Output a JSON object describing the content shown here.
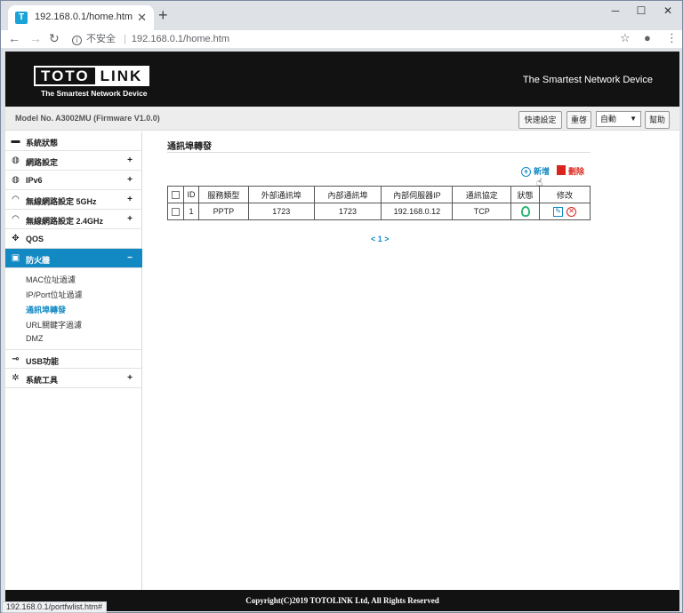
{
  "browser": {
    "tab_title": "192.168.0.1/home.htm",
    "favicon_letter": "T",
    "security_label": "不安全",
    "url": "192.168.0.1/home.htm",
    "status_url": "192.168.0.1/portfwlist.htm#"
  },
  "header": {
    "logo_left": "TOTO",
    "logo_right": "LINK",
    "logo_sub": "The Smartest Network Device",
    "slogan": "The Smartest Network Device"
  },
  "modelbar": {
    "model": "Model No. A3002MU (Firmware V1.0.0)",
    "quick_setup": "快速設定",
    "reboot": "重啓",
    "language": "自動",
    "help": "幫助"
  },
  "sidebar": {
    "items": [
      {
        "label": "系統狀態",
        "icon": "chat-icon",
        "glyph": "▬",
        "plus": ""
      },
      {
        "label": "網路設定",
        "icon": "globe-icon",
        "glyph": "◍",
        "plus": "+"
      },
      {
        "label": "IPv6",
        "icon": "globe-icon",
        "glyph": "◍",
        "plus": "+"
      },
      {
        "label": "無線網路設定 5GHz",
        "icon": "wifi-icon",
        "glyph": "◠",
        "plus": "+"
      },
      {
        "label": "無線網路設定 2.4GHz",
        "icon": "wifi-icon",
        "glyph": "◠",
        "plus": "+"
      },
      {
        "label": "QOS",
        "icon": "qos-icon",
        "glyph": "✥",
        "plus": ""
      },
      {
        "label": "防火牆",
        "icon": "lock-icon",
        "glyph": "▣",
        "plus": "−"
      },
      {
        "label": "USB功能",
        "icon": "usb-icon",
        "glyph": "⊸",
        "plus": ""
      },
      {
        "label": "系統工具",
        "icon": "gear-icon",
        "glyph": "✲",
        "plus": "+"
      }
    ],
    "firewall_sub": [
      "MAC位址過濾",
      "IP/Port位址過濾",
      "通訊埠轉發",
      "URL關鍵字過濾",
      "DMZ"
    ]
  },
  "main": {
    "title": "通訊埠轉發",
    "add_label": "新增",
    "delete_label": "刪除",
    "columns": [
      "",
      "ID",
      "服務類型",
      "外部通訊埠",
      "內部通訊埠",
      "內部伺服器IP",
      "通訊協定",
      "狀態",
      "修改"
    ],
    "rows": [
      {
        "id": "1",
        "service": "PPTP",
        "ext_port": "1723",
        "int_port": "1723",
        "server_ip": "192.168.0.12",
        "protocol": "TCP"
      }
    ],
    "pager": "< 1 >"
  },
  "footer": {
    "copyright": "Copyright(C)2019 TOTOLINK Ltd, All Rights Reserved"
  },
  "colors": {
    "accent": "#1389c4",
    "header_bg": "#121212",
    "status_green": "#2bb673",
    "delete_red": "#d9261c"
  }
}
